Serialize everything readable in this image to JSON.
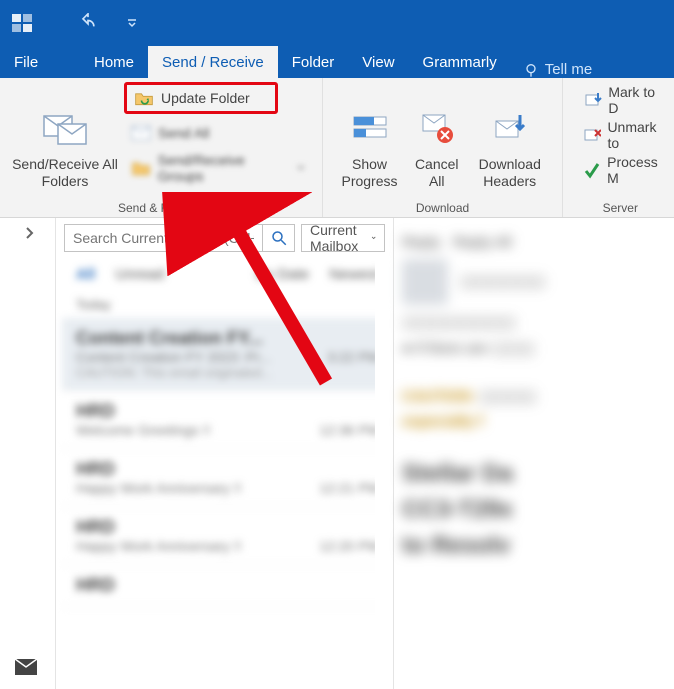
{
  "titlebar": {},
  "tabs": {
    "file": "File",
    "home": "Home",
    "send_receive": "Send / Receive",
    "folder": "Folder",
    "view": "View",
    "grammarly": "Grammarly",
    "tell_me": "Tell me"
  },
  "ribbon": {
    "send_receive_group": {
      "caption": "Send & Receive",
      "send_all": "Send/Receive All Folders",
      "update_folder": "Update Folder",
      "send_all_small": "Send All",
      "send_receive_groups": "Send/Receive Groups"
    },
    "download_group": {
      "caption": "Download",
      "show_progress": "Show Progress",
      "cancel_all": "Cancel All",
      "download_headers": "Download Headers"
    },
    "server_group": {
      "caption": "Server",
      "mark_download": "Mark to D",
      "unmark": "Unmark to",
      "process": "Process M"
    }
  },
  "search": {
    "placeholder": "Search Current Mailbox (Ctrl+E)",
    "scope": "Current Mailbox"
  },
  "list": {
    "filters": {
      "all": "All",
      "unread": "Unread",
      "bydate": "By Date",
      "newest": "Newest"
    },
    "date_header": "Today",
    "items": [
      {
        "title": "Content Creation FY...",
        "sub": "Content Creation FY 2023 :Pr...",
        "time": "3:22 PM",
        "preview": "CAUTION: This email originated..."
      },
      {
        "title": "HRD",
        "sub": "Welcome Greetings !!",
        "time": "12:36 PM",
        "preview": ""
      },
      {
        "title": "HRD",
        "sub": "Happy Work Anniversary !!",
        "time": "12:21 PM",
        "preview": ""
      },
      {
        "title": "HRD",
        "sub": "Happy Work Anniversary !!",
        "time": "12:20 PM",
        "preview": ""
      },
      {
        "title": "HRD",
        "sub": "",
        "time": "",
        "preview": ""
      }
    ]
  },
  "reading": {
    "reply": "Reply",
    "reply_all": "Reply All",
    "caution": "CAUTION:",
    "caution2": "especially f",
    "headline1": "Stellar Da",
    "headline2": "CC3-T29x",
    "headline3": "to Resolv"
  }
}
